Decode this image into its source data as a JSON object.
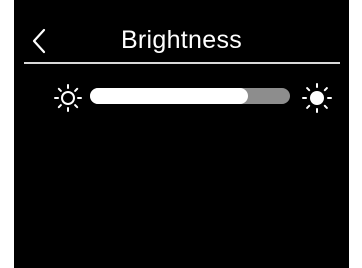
{
  "header": {
    "title": "Brightness",
    "back_icon": "chevron-left-icon"
  },
  "brightness": {
    "level": 0.79,
    "low_icon": "sun-outline-icon",
    "high_icon": "sun-filled-icon"
  },
  "colors": {
    "background": "#000000",
    "text": "#ffffff",
    "fill": "#ffffff",
    "track": "#8d8d8d",
    "divider": "#d9d9d9"
  }
}
